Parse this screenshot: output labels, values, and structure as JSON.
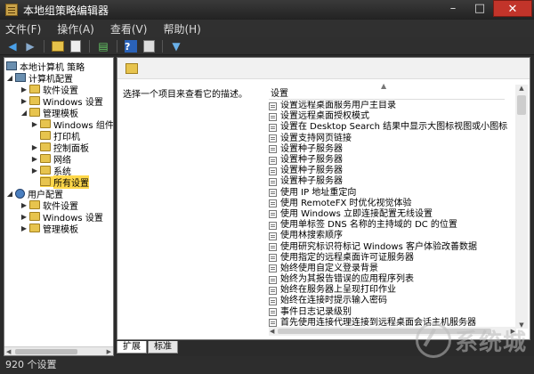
{
  "window": {
    "title": "本地组策略编辑器"
  },
  "window_controls": {
    "minimize": "–",
    "maximize": "□",
    "close": "✕"
  },
  "menu": [
    "文件(F)",
    "操作(A)",
    "查看(V)",
    "帮助(H)"
  ],
  "tree": {
    "root": "本地计算机 策略",
    "computer_config": "计算机配置",
    "computer_children": [
      "软件设置",
      "Windows 设置",
      "管理模板"
    ],
    "admin_templates_children": [
      "Windows 组件",
      "打印机",
      "控制面板",
      "网络",
      "系统",
      "所有设置"
    ],
    "user_config": "用户配置",
    "user_children": [
      "软件设置",
      "Windows 设置",
      "管理模板"
    ]
  },
  "right_pane": {
    "description": "选择一个项目来查看它的描述。",
    "column_header": "设置",
    "settings": [
      "设置远程桌面服务用户主目录",
      "设置远程桌面授权模式",
      "设置在 Desktop Search 结果中显示大图标视图或小图标视图",
      "设置支持网页链接",
      "设置种子服务器",
      "设置种子服务器",
      "设置种子服务器",
      "设置种子服务器",
      "使用 IP 地址重定向",
      "使用 RemoteFX 时优化视觉体验",
      "使用 Windows 立即连接配置无线设置",
      "使用单标签 DNS 名称的主持域的 DC 的位置",
      "使用林搜索顺序",
      "使用研究标识符标记 Windows 客户体验改善数据",
      "使用指定的远程桌面许可证服务器",
      "始终使用自定义登录背景",
      "始终为其报告错误的应用程序列表",
      "始终在服务器上呈现打印作业",
      "始终在连接时提示输入密码",
      "事件日志记录级别",
      "首先使用连接代理连接到远程桌面会话主机服务器"
    ]
  },
  "tabs": [
    "扩展",
    "标准"
  ],
  "status": "920 个设置",
  "watermark": "系统城"
}
